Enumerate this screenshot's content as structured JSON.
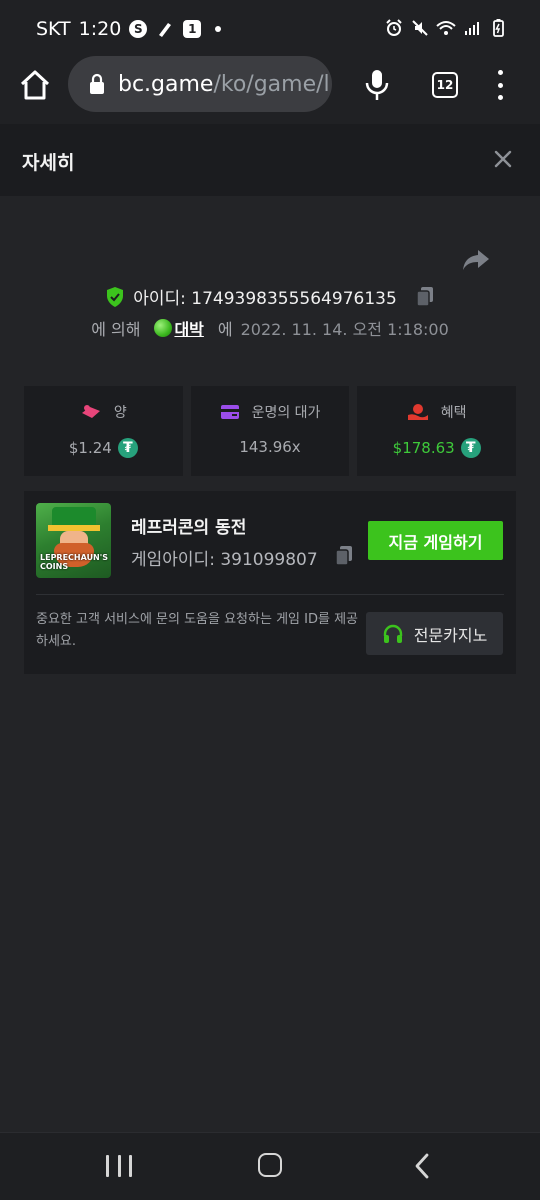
{
  "status_bar": {
    "carrier": "SKT",
    "time": "1:20",
    "badge_letter": "S",
    "badge_number": "1"
  },
  "browser": {
    "url_host": "bc.game",
    "url_path": "/ko/game/l",
    "tab_count": "12"
  },
  "modal": {
    "title": "자세히"
  },
  "bet": {
    "id_label": "아이디: 1749398355564976135",
    "by_label": "에 의해",
    "username": "대박",
    "at_label": "에",
    "datetime": "2022. 11. 14. 오전 1:18:00"
  },
  "stats": [
    {
      "label": "양",
      "value": "$1.24",
      "icon": "bet-amount-icon",
      "icon_color": "#e8457a"
    },
    {
      "label": "운명의 대가",
      "value": "143.96x",
      "icon": "payout-card-icon",
      "icon_color": "#9b4dea"
    },
    {
      "label": "혜택",
      "value": "$178.63",
      "icon": "profit-hand-icon",
      "icon_color": "#e0392f",
      "value_color": "#3ec93a"
    }
  ],
  "game": {
    "thumbnail_text": "LEPRECHAUN'S COINS",
    "name": "레프러콘의 동전",
    "game_id_label": "게임아이디: 391099807",
    "play_button": "지금 게임하기",
    "help_text": "중요한 고객 서비스에 문의 도움을 요청하는 게임 ID를 제공하세요.",
    "support_button": "전문카지노"
  },
  "colors": {
    "accent_green": "#3cc31d",
    "background": "#232427",
    "panel": "#1b1c1f"
  }
}
